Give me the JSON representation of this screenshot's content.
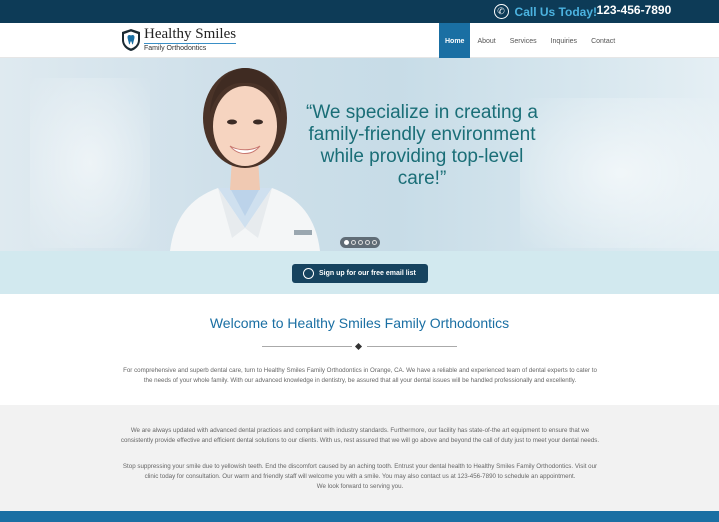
{
  "topbar": {
    "cta": "Call Us Today!",
    "phone": "123-456-7890",
    "icon": "phone-icon"
  },
  "header": {
    "logo_name": "Healthy Smiles",
    "logo_sub": "Family Orthodontics",
    "nav": [
      {
        "label": "Home",
        "active": true
      },
      {
        "label": "About",
        "active": false
      },
      {
        "label": "Services",
        "active": false
      },
      {
        "label": "Inquiries",
        "active": false
      },
      {
        "label": "Contact",
        "active": false
      }
    ]
  },
  "hero": {
    "quote": "“We specialize in creating a family-friendly environment while providing top-level care!”",
    "slide_count": 5,
    "active_slide": 1
  },
  "signup": {
    "label": "Sign up for our free email list"
  },
  "welcome": {
    "title": "Welcome to Healthy Smiles Family Orthodontics",
    "text": "For comprehensive and superb dental care, turn to Healthy Smiles Family Orthodontics in Orange, CA. We have a reliable and experienced team of dental experts to cater to the needs of your whole family. With our advanced knowledge in dentistry, be assured that all your dental issues will be handled professionally and excellently."
  },
  "info": {
    "p1": "We are always updated with advanced dental practices and compliant with industry standards. Furthermore, our facility has state-of-the art equipment to ensure that we consistently provide effective and efficient dental solutions to our clients. With us, rest assured that we will go above and beyond the call of duty just to meet your dental needs.",
    "p2": "Stop suppressing your smile due to yellowish teeth. End the discomfort caused by an aching tooth. Entrust your dental health to Healthy Smiles Family Orthodontics. Visit our clinic today for consultation. Our warm and friendly staff will welcome you with a smile. You may also contact us at 123-456-7890 to schedule an appointment.",
    "p3": "We look forward to serving you."
  },
  "colors": {
    "topbar": "#0d3b57",
    "accent": "#1a6fa3",
    "cta": "#4cb3e0",
    "quote": "#1a6e77"
  }
}
